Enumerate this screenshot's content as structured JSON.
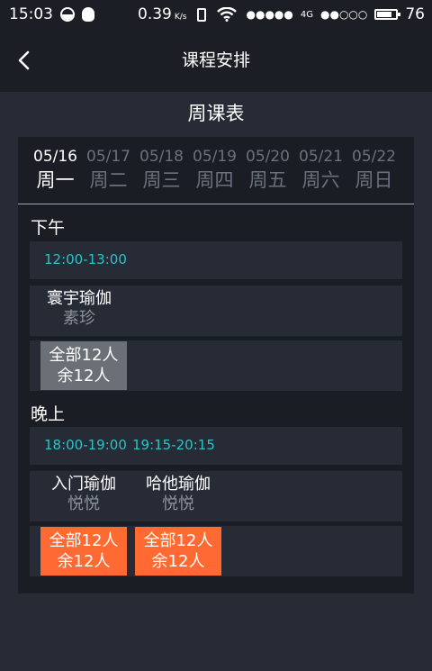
{
  "status_bar": {
    "time": "15:03",
    "speed": "0.39",
    "speed_unit": "K/s",
    "signal_dots": "●●●●●",
    "network": "4G",
    "signal_dots_2": "●●○○○",
    "battery": "76"
  },
  "nav": {
    "title": "课程安排"
  },
  "schedule_title": "周课表",
  "days": [
    {
      "date": "05/16",
      "week": "周一"
    },
    {
      "date": "05/17",
      "week": "周二"
    },
    {
      "date": "05/18",
      "week": "周三"
    },
    {
      "date": "05/19",
      "week": "周四"
    },
    {
      "date": "05/20",
      "week": "周五"
    },
    {
      "date": "05/21",
      "week": "周六"
    },
    {
      "date": "05/22",
      "week": "周日"
    }
  ],
  "afternoon": {
    "label": "下午",
    "times": [
      "12:00-13:00"
    ],
    "courses": [
      {
        "name": "寰宇瑜伽",
        "teacher": "素珍"
      }
    ],
    "slots": [
      {
        "total": "全部12人",
        "remaining": "余12人",
        "state": "full"
      }
    ]
  },
  "evening": {
    "label": "晚上",
    "times": [
      "18:00-19:00",
      "19:15-20:15"
    ],
    "courses": [
      {
        "name": "入门瑜伽",
        "teacher": "悦悦"
      },
      {
        "name": "哈他瑜伽",
        "teacher": "悦悦"
      }
    ],
    "slots": [
      {
        "total": "全部12人",
        "remaining": "余12人",
        "state": "open"
      },
      {
        "total": "全部12人",
        "remaining": "余12人",
        "state": "open"
      }
    ]
  },
  "colors": {
    "background": "#262b35",
    "bar": "#1b1f25",
    "panel": "#1a1e24",
    "accent_time": "#2cc2c8",
    "open_slot": "#ff6a33",
    "full_slot": "#6b7077"
  }
}
